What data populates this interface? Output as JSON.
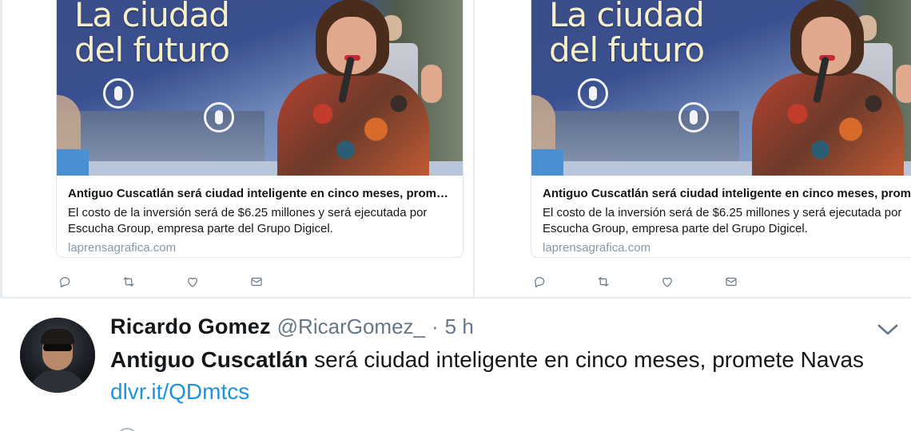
{
  "cards": [
    {
      "image_title_line1": "La ciudad",
      "image_title_line2": "del futuro",
      "title": "Antiguo Cuscatlán será ciudad inteligente en cinco meses, promete …",
      "description": "El costo de la inversión será de $6.25 millones y será ejecutada por Escucha Group, empresa parte del Grupo Digicel.",
      "domain": "laprensagrafica.com"
    },
    {
      "image_title_line1": "La ciudad",
      "image_title_line2": "del futuro",
      "title": "Antiguo Cuscatlán será ciudad inteligente en cinco meses, promete Navas",
      "description": "El costo de la inversión será de $6.25 millones y será ejecutada por Escucha Group, empresa parte del Grupo Digicel.",
      "domain": "laprensagrafica.com"
    }
  ],
  "actions": [
    "reply-icon",
    "retweet-icon",
    "like-icon",
    "message-icon"
  ],
  "tweet": {
    "name": "Ricardo Gomez",
    "handle": "@RicarGomez_",
    "dot": "·",
    "time": "5 h",
    "text_bold": "Antiguo Cuscatlán",
    "text_rest": " será ciudad inteligente en cinco meses, promete Navas",
    "link": "dlvr.it/QDmtcs"
  },
  "colors": {
    "link": "#1b95e0",
    "secondary": "#657786",
    "border": "#e1e8ed"
  }
}
